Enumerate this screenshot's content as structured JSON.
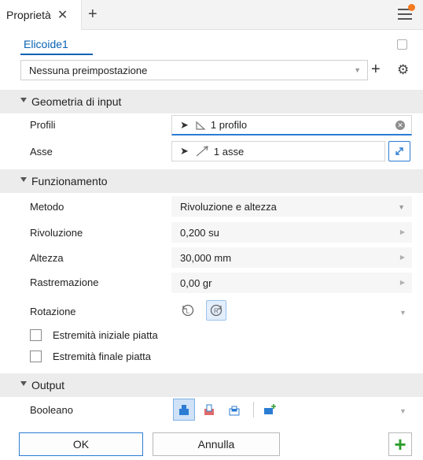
{
  "tab": {
    "title": "Proprietà",
    "close": "✕",
    "add": "+"
  },
  "feature": {
    "name": "Elicoide1"
  },
  "preset": {
    "value": "Nessuna preimpostazione",
    "add": "+",
    "settings": "⚙"
  },
  "sections": {
    "input": {
      "title": "Geometria di input"
    },
    "behavior": {
      "title": "Funzionamento"
    },
    "output": {
      "title": "Output"
    }
  },
  "input_geometry": {
    "profiles": {
      "label": "Profili",
      "value": "1 profilo"
    },
    "axis": {
      "label": "Asse",
      "value": "1 asse"
    }
  },
  "behavior": {
    "method": {
      "label": "Metodo",
      "value": "Rivoluzione e altezza"
    },
    "revolution": {
      "label": "Rivoluzione",
      "value": "0,200 su"
    },
    "height": {
      "label": "Altezza",
      "value": "30,000 mm"
    },
    "taper": {
      "label": "Rastremazione",
      "value": "0,00 gr"
    },
    "rotation": {
      "label": "Rotazione"
    },
    "flat_start": {
      "label": "Estremità iniziale piatta",
      "checked": false
    },
    "flat_end": {
      "label": "Estremità finale piatta",
      "checked": false
    }
  },
  "output": {
    "boolean": {
      "label": "Booleano",
      "selected": "join"
    }
  },
  "footer": {
    "ok": "OK",
    "cancel": "Annulla",
    "add": "+"
  },
  "colors": {
    "accent": "#2b7cd3",
    "link": "#0a62b3",
    "notify": "#f47b20",
    "add_green": "#2e9d2e"
  }
}
